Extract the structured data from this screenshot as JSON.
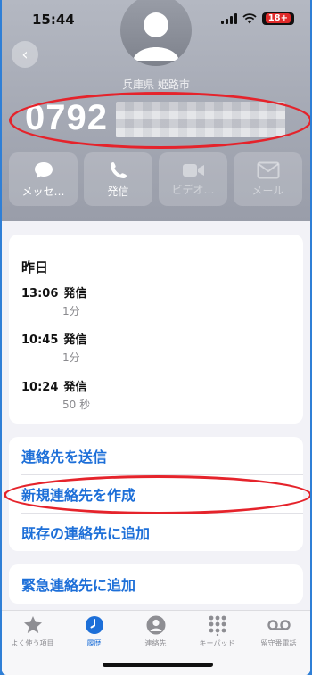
{
  "status_bar": {
    "time": "15:44",
    "battery_label": "18+"
  },
  "contact": {
    "location": "兵庫県 姫路市",
    "number_visible": "0792",
    "avatar_icon": "person-icon",
    "back_icon": "chevron-left-icon"
  },
  "actions": [
    {
      "label": "メッセ…",
      "icon": "message-bubble-icon",
      "enabled": true
    },
    {
      "label": "発信",
      "icon": "phone-icon",
      "enabled": true
    },
    {
      "label": "ビデオ…",
      "icon": "video-camera-icon",
      "enabled": false
    },
    {
      "label": "メール",
      "icon": "envelope-icon",
      "enabled": false
    }
  ],
  "history": {
    "title": "昨日",
    "entries": [
      {
        "time": "13:06",
        "type": "発信",
        "duration": "1分"
      },
      {
        "time": "10:45",
        "type": "発信",
        "duration": "1分"
      },
      {
        "time": "10:24",
        "type": "発信",
        "duration": "50 秒"
      }
    ]
  },
  "options": {
    "send_contact": "連絡先を送信",
    "create_new_contact": "新規連絡先を作成",
    "add_to_existing": "既存の連絡先に追加",
    "add_to_emergency": "緊急連絡先に追加"
  },
  "tabbar": [
    {
      "label": "よく使う項目",
      "icon": "star-icon",
      "active": false
    },
    {
      "label": "履歴",
      "icon": "clock-icon",
      "active": true
    },
    {
      "label": "連絡先",
      "icon": "person-circle-icon",
      "active": false
    },
    {
      "label": "キーパッド",
      "icon": "keypad-icon",
      "active": false
    },
    {
      "label": "留守番電話",
      "icon": "voicemail-icon",
      "active": false
    }
  ],
  "colors": {
    "accent": "#1d6fd8",
    "annotation_red": "#e5232b",
    "header_gray": "#a7abb6"
  }
}
